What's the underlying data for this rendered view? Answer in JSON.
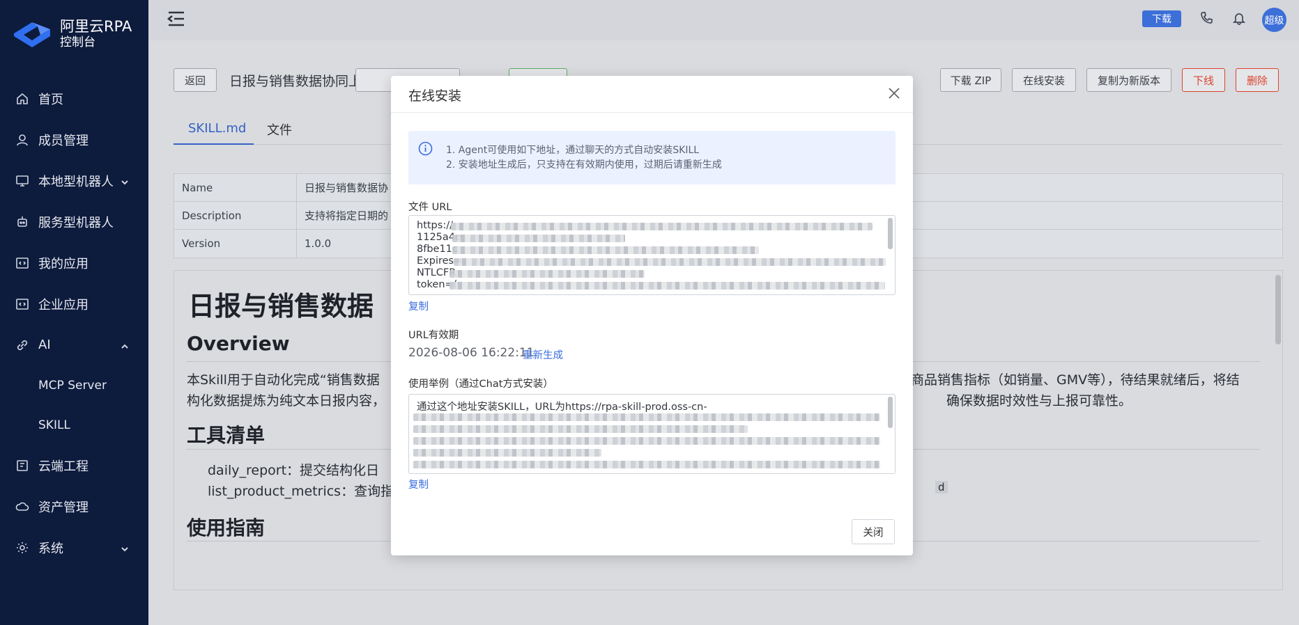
{
  "brand": {
    "name": "阿里云RPA",
    "subtitle": "控制台"
  },
  "sidebar": {
    "items": [
      {
        "label": "首页",
        "icon": "home-icon"
      },
      {
        "label": "成员管理",
        "icon": "user-icon"
      },
      {
        "label": "本地型机器人",
        "icon": "monitor-icon",
        "expanded": false
      },
      {
        "label": "服务型机器人",
        "icon": "robot-icon"
      },
      {
        "label": "我的应用",
        "icon": "code-icon"
      },
      {
        "label": "企业应用",
        "icon": "code-icon"
      },
      {
        "label": "AI",
        "icon": "link-icon",
        "expanded": true
      },
      {
        "label": "MCP Server",
        "sub": true
      },
      {
        "label": "SKILL",
        "sub": true
      },
      {
        "label": "云端工程",
        "icon": "project-icon"
      },
      {
        "label": "资产管理",
        "icon": "cloud-icon"
      },
      {
        "label": "系统",
        "icon": "gear-icon",
        "expanded": false
      }
    ]
  },
  "header": {
    "download_label": "下载",
    "avatar_text": "超级"
  },
  "page": {
    "back_label": "返回",
    "title": "日报与销售数据协同上报",
    "actions": {
      "download_zip": "下载 ZIP",
      "online_install": "在线安装",
      "copy_new_version": "复制为新版本",
      "offline": "下线",
      "delete": "删除"
    },
    "tabs": [
      "SKILL.md",
      "文件"
    ],
    "meta": [
      {
        "key": "Name",
        "value": "日报与销售数据协"
      },
      {
        "key": "Description",
        "value": "支持将指定日期的"
      },
      {
        "key": "Version",
        "value": "1.0.0"
      }
    ],
    "doc": {
      "h1": "日报与销售数据",
      "overview_heading": "Overview",
      "overview_line1_left": "本Skill用于自动化完成“销售数据",
      "overview_line1_right": "商品销售指标（如销量、GMV等），待结果就绪后，将结",
      "overview_line2_left": "构化数据提炼为纯文本日报内容，",
      "overview_line2_right": "确保数据时效性与上报可靠性。",
      "tools_heading": "工具清单",
      "tool1": "daily_report：提交结构化日",
      "tool2": "list_product_metrics：查询指",
      "tool2_tail": "d",
      "guide_heading": "使用指南"
    }
  },
  "modal": {
    "title": "在线安装",
    "alert_line1": "1. Agent可使用如下地址，通过聊天的方式自动安装SKILL",
    "alert_line2": "2. 安装地址生成后，只支持在有效期内使用，过期后请重新生成",
    "file_url_label": "文件 URL",
    "file_url_lines": [
      "https://",
      "1125a4e",
      "8fbe11c",
      "Expires=",
      "NTLCFR",
      "token=("
    ],
    "copy_label": "复制",
    "url_validity_label": "URL有效期",
    "expiry": "2026-08-06 16:22:11",
    "regenerate_label": "重新生成",
    "example_label": "使用举例（通过Chat方式安装）",
    "example_text": "通过这个地址安装SKILL，URL为https://rpa-skill-prod.oss-cn-",
    "close_label": "关闭"
  }
}
